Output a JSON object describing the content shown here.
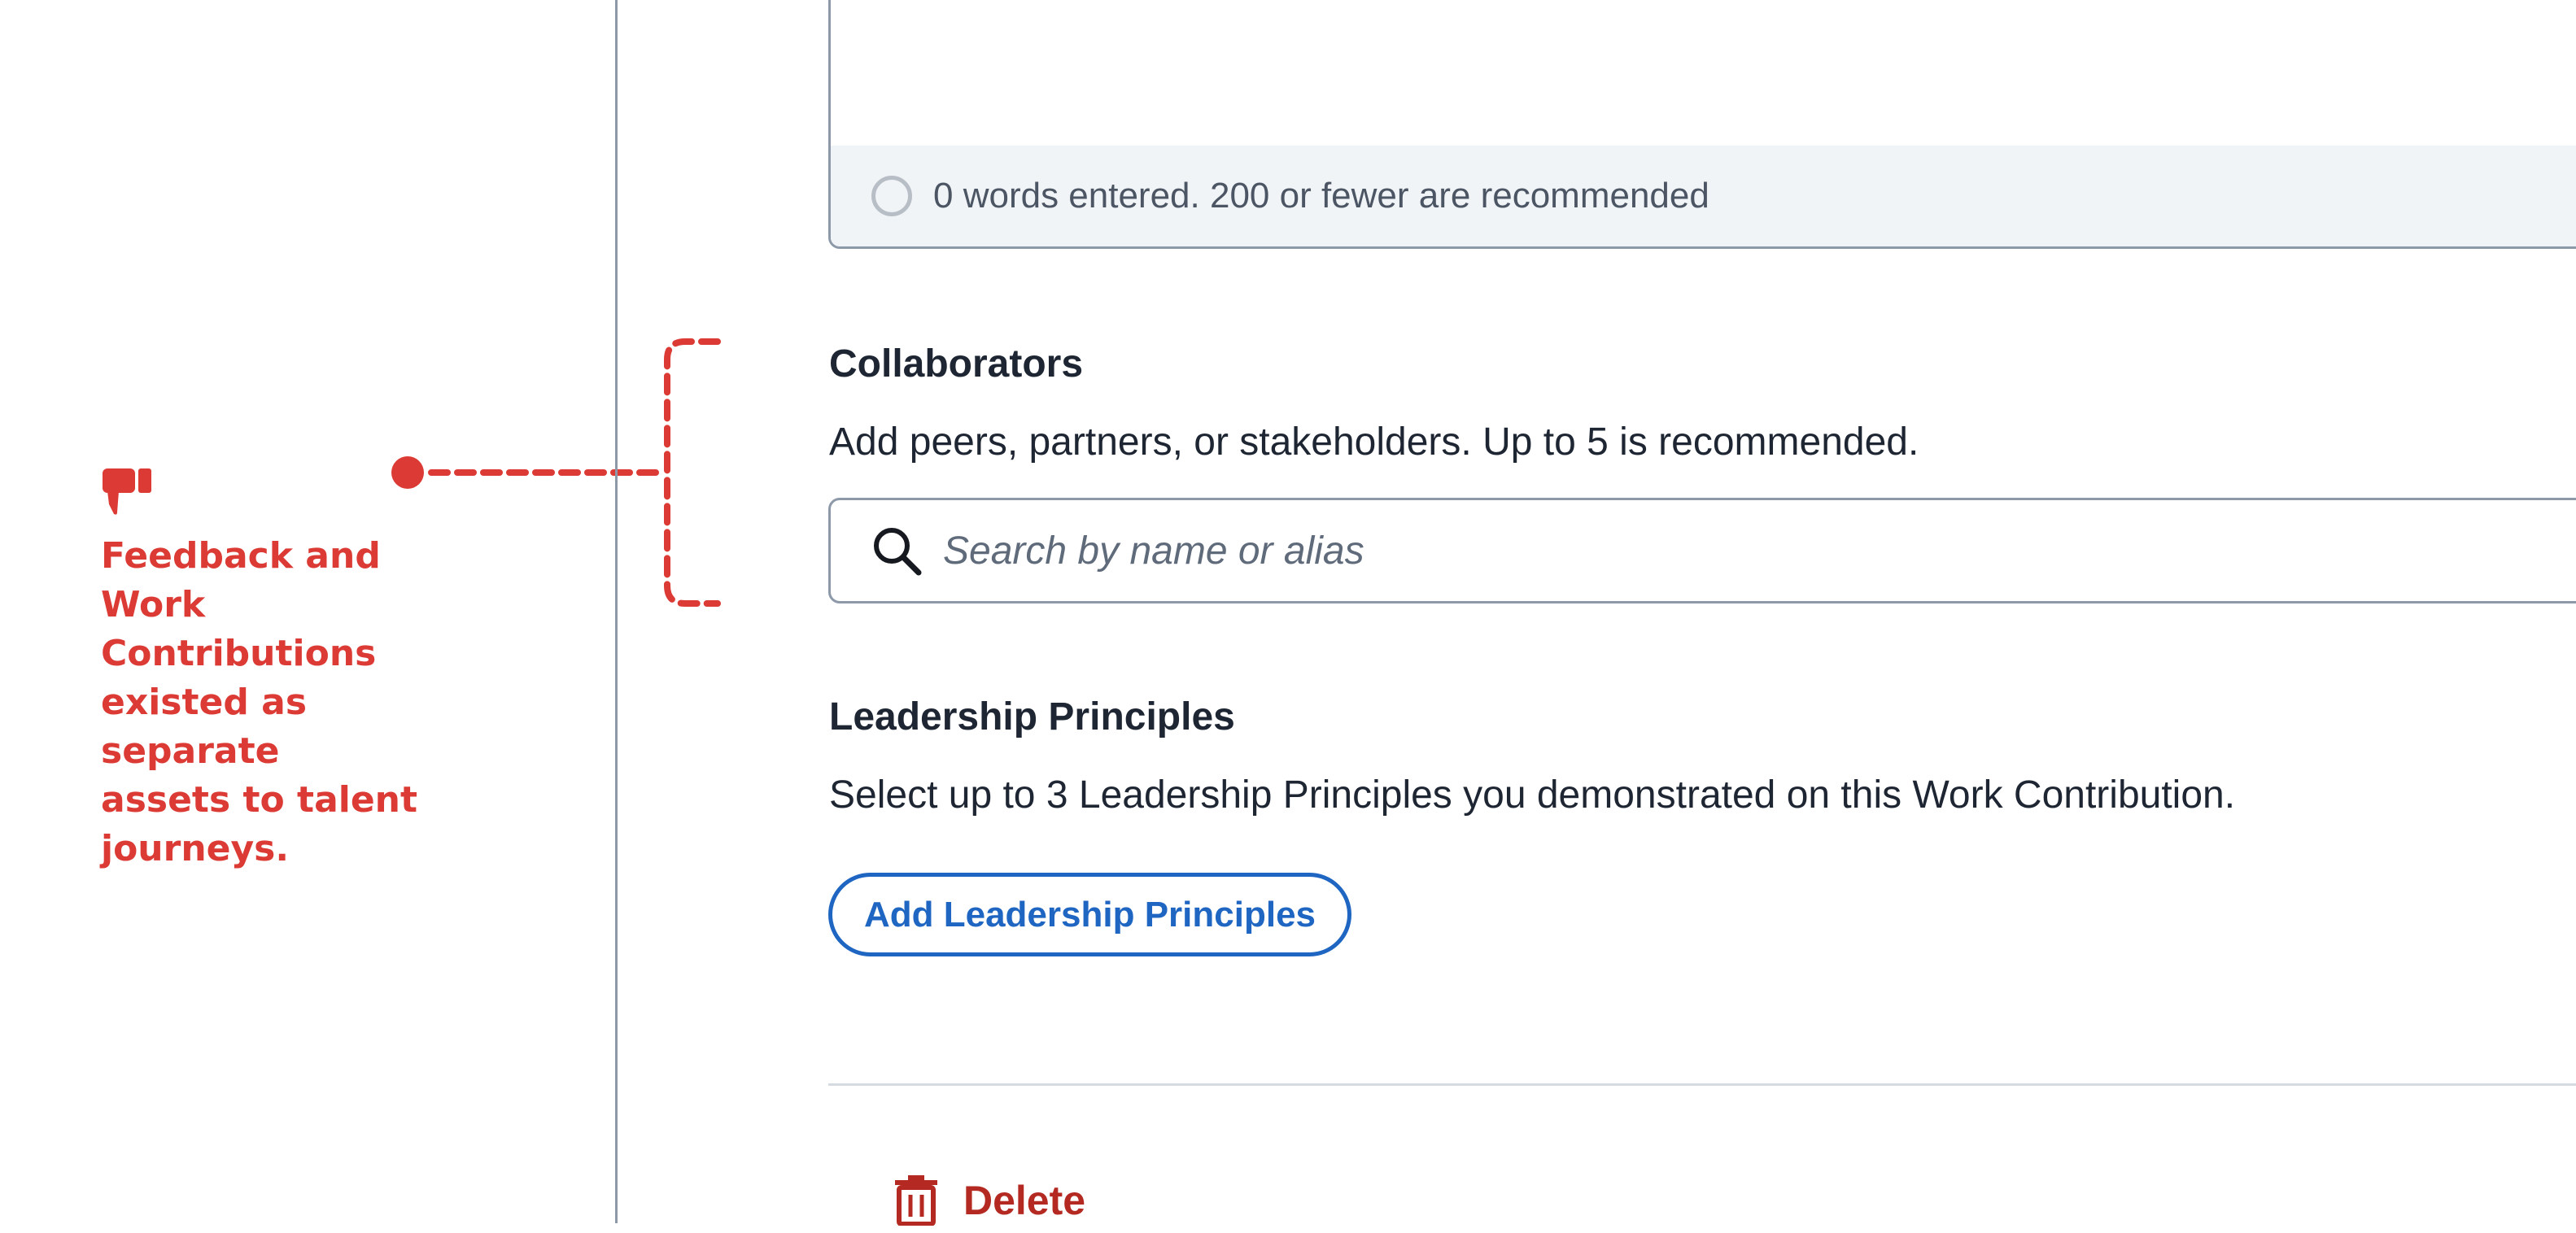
{
  "annotation": {
    "note": "Feedback and Work Contributions existed as separate assets to talent journeys.",
    "icon": "thumbs-down-icon",
    "color": "#dc3b35"
  },
  "editor": {
    "word_counter": "0 words entered. 200 or fewer are recommended"
  },
  "collaborators": {
    "title": "Collaborators",
    "description": "Add peers, partners, or stakeholders. Up to 5 is recommended.",
    "search_placeholder": "Search by name or alias"
  },
  "leadership_principles": {
    "title": "Leadership Principles",
    "description": "Select up to 3 Leadership Principles you demonstrated on this Work Contribution.",
    "add_button_label": "Add Leadership Principles"
  },
  "actions": {
    "delete_label": "Delete"
  },
  "colors": {
    "primary_blue": "#1f66c2",
    "danger_red": "#b42a22",
    "text_dark": "#1e2633",
    "border_gray": "#8d99a8"
  }
}
